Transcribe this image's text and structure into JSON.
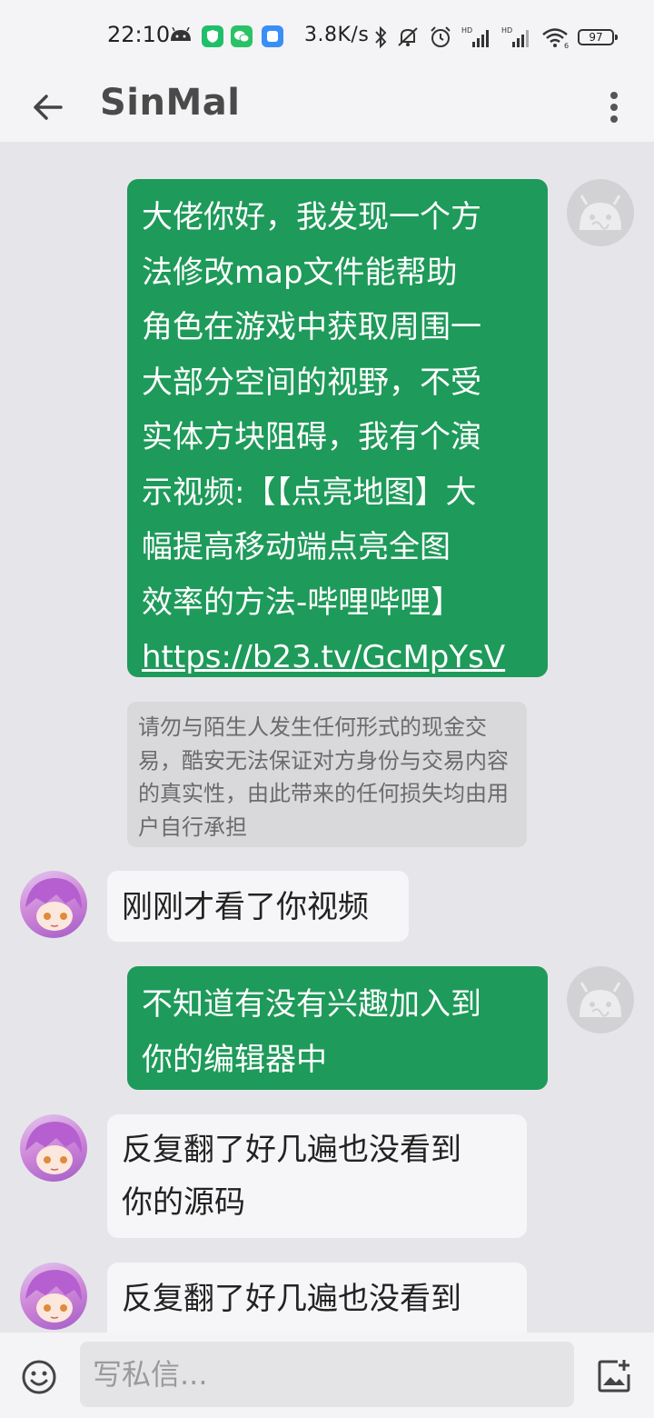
{
  "status_bar": {
    "time": "22:10",
    "net_speed": "3.8K/s",
    "battery": "97",
    "icons": [
      "android-icon",
      "shield-app-icon",
      "wechat-icon",
      "app-icon",
      "bluetooth-icon",
      "mute-icon",
      "alarm-icon",
      "signal-hd-icon",
      "signal-hd-icon",
      "wifi-icon",
      "battery-icon"
    ]
  },
  "header": {
    "title": "SinMal"
  },
  "messages": [
    {
      "sender": "me",
      "lines": [
        "大佬你好，我发现一个方",
        "法修改map文件能帮助",
        "角色在游戏中获取周围一",
        "大部分空间的视野，不受",
        "实体方块阻碍，我有个演",
        "示视频:【【点亮地图】大",
        "幅提高移动端点亮全图",
        "效率的方法-哔哩哔哩】"
      ],
      "link": "https://b23.tv/GcMpYsV"
    },
    {
      "type": "warning",
      "text": "请勿与陌生人发生任何形式的现金交易，酷安无法保证对方身份与交易内容的真实性，由此带来的任何损失均由用户自行承担"
    },
    {
      "sender": "them",
      "text": "刚刚才看了你视频"
    },
    {
      "sender": "me",
      "lines": [
        "不知道有没有兴趣加入到",
        "你的编辑器中"
      ]
    },
    {
      "sender": "them",
      "lines": [
        "反复翻了好几遍也没看到",
        "你的源码"
      ]
    },
    {
      "sender": "them",
      "lines": [
        "反复翻了好几遍也没看到"
      ]
    }
  ],
  "composer": {
    "placeholder": "写私信..."
  },
  "colors": {
    "my_bubble": "#1e9a5a",
    "their_bubble": "#f6f6f8",
    "background": "#e6e6ea"
  }
}
